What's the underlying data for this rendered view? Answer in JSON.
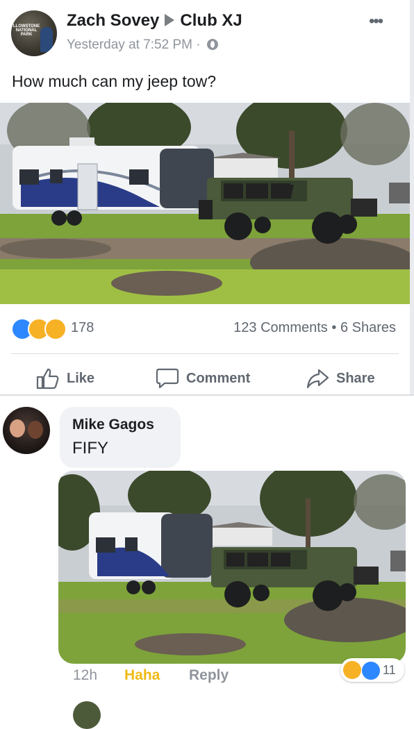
{
  "post": {
    "author": "Zach Sovey",
    "group": "Club XJ",
    "timestamp": "Yesterday at 7:52 PM",
    "separator": "·",
    "text": "How much can my jeep tow?",
    "avatar_sign_text": "LLOWSTONE NATIONAL PARK",
    "reaction_count": "178",
    "comments_count": "123 Comments",
    "shares_count": "6 Shares",
    "stats_separator": "•"
  },
  "actions": {
    "like_label": "Like",
    "comment_label": "Comment",
    "share_label": "Share"
  },
  "comment": {
    "author": "Mike Gagos",
    "text": "FIFY",
    "time": "12h",
    "reaction_label": "Haha",
    "reply_label": "Reply",
    "reaction_count": "11"
  },
  "colors": {
    "facebook_blue": "#2d88ff",
    "haha_yellow": "#f7b125",
    "haha_label": "#f0ba15",
    "secondary_text": "#606770"
  },
  "icons": [
    "globe-icon",
    "more-icon",
    "like-icon",
    "comment-icon",
    "share-icon",
    "arrow-icon"
  ]
}
